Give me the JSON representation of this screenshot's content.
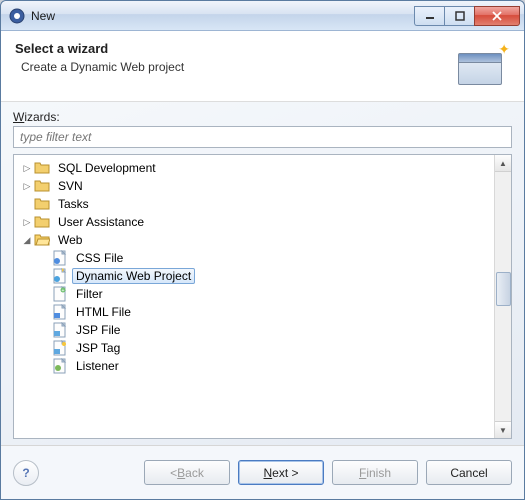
{
  "window": {
    "title": "New"
  },
  "header": {
    "title": "Select a wizard",
    "subtitle": "Create a Dynamic Web project"
  },
  "wizards": {
    "label": "Wizards:",
    "filter_placeholder": "type filter text"
  },
  "tree": {
    "items": [
      {
        "label": "SQL Development",
        "level": 0,
        "type": "folder",
        "expander": "collapsed"
      },
      {
        "label": "SVN",
        "level": 0,
        "type": "folder",
        "expander": "collapsed"
      },
      {
        "label": "Tasks",
        "level": 0,
        "type": "folder",
        "expander": "none"
      },
      {
        "label": "User Assistance",
        "level": 0,
        "type": "folder",
        "expander": "collapsed"
      },
      {
        "label": "Web",
        "level": 0,
        "type": "folder-open",
        "expander": "expanded"
      },
      {
        "label": "CSS File",
        "level": 1,
        "type": "file-css",
        "expander": "none"
      },
      {
        "label": "Dynamic Web Project",
        "level": 1,
        "type": "file-dwp",
        "expander": "none",
        "selected": true
      },
      {
        "label": "Filter",
        "level": 1,
        "type": "file-filter",
        "expander": "none"
      },
      {
        "label": "HTML File",
        "level": 1,
        "type": "file-html",
        "expander": "none"
      },
      {
        "label": "JSP File",
        "level": 1,
        "type": "file-jsp",
        "expander": "none"
      },
      {
        "label": "JSP Tag",
        "level": 1,
        "type": "file-jsptag",
        "expander": "none"
      },
      {
        "label": "Listener",
        "level": 1,
        "type": "file-listener",
        "expander": "none"
      }
    ]
  },
  "buttons": {
    "back": "< Back",
    "next": "Next >",
    "finish": "Finish",
    "cancel": "Cancel"
  }
}
